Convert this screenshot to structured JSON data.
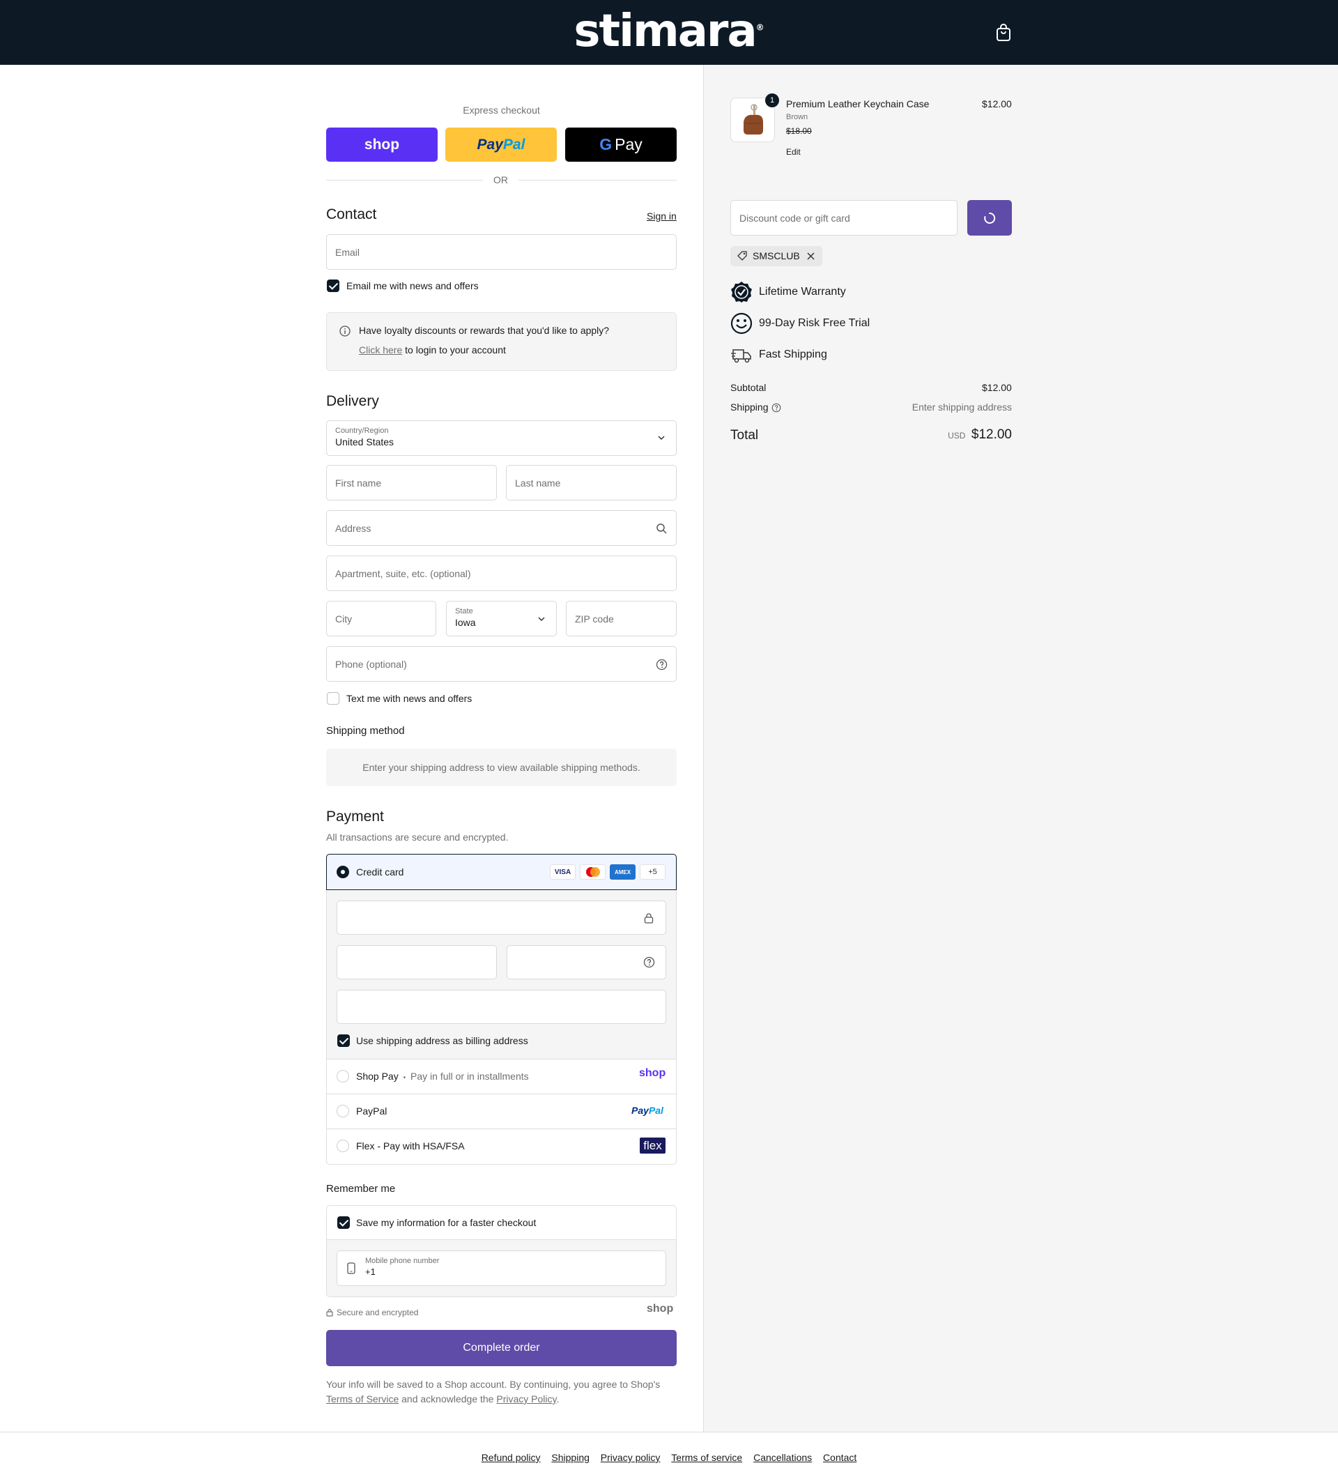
{
  "header": {
    "logo": "stimara",
    "logo_mark": "®"
  },
  "express": {
    "label": "Express checkout",
    "shop_label": "shop",
    "paypal_pay": "Pay",
    "paypal_pal": "Pal",
    "gpay_g": "G",
    "gpay_label": "Pay",
    "or": "OR"
  },
  "contact": {
    "heading": "Contact",
    "sign_in": "Sign in",
    "email_placeholder": "Email",
    "news_label": "Email me with news and offers",
    "loyalty_text": "Have loyalty discounts or rewards that you'd like to apply?",
    "loyalty_link": "Click here",
    "loyalty_suffix": "to login to your account"
  },
  "delivery": {
    "heading": "Delivery",
    "country_label": "Country/Region",
    "country_value": "United States",
    "first_name": "First name",
    "last_name": "Last name",
    "address": "Address",
    "apartment": "Apartment, suite, etc. (optional)",
    "city": "City",
    "state_label": "State",
    "state_value": "Iowa",
    "zip": "ZIP code",
    "phone": "Phone (optional)",
    "text_label": "Text me with news and offers"
  },
  "shipping_method": {
    "heading": "Shipping method",
    "info": "Enter your shipping address to view available shipping methods."
  },
  "payment": {
    "heading": "Payment",
    "subtitle": "All transactions are secure and encrypted.",
    "credit_card": "Credit card",
    "cards": [
      "VISA",
      "AMEX",
      "+5"
    ],
    "billing_label": "Use shipping address as billing address",
    "shop_pay": "Shop Pay",
    "shop_pay_sep": "•",
    "shop_pay_desc": "Pay in full or in installments",
    "shop_logo": "shop",
    "paypal": "PayPal",
    "paypal_pay": "Pay",
    "paypal_pal": "Pal",
    "flex": "Flex - Pay with HSA/FSA",
    "flex_logo": "flex"
  },
  "remember": {
    "heading": "Remember me",
    "save_label": "Save my information for a faster checkout",
    "mobile_label": "Mobile phone number",
    "mobile_value": "+1",
    "secure": "Secure and encrypted",
    "shop_logo": "shop"
  },
  "complete": {
    "button": "Complete order",
    "notice_1": "Your info will be saved to a Shop account. By continuing, you agree to Shop's",
    "tos": "Terms of Service",
    "notice_2": "and acknowledge the",
    "privacy": "Privacy Policy",
    "notice_end": "."
  },
  "summary": {
    "product_name": "Premium Leather Keychain Case",
    "variant": "Brown",
    "old_price": "$18.00",
    "price": "$12.00",
    "qty": "1",
    "edit": "Edit",
    "discount_placeholder": "Discount code or gift card",
    "applied_code": "SMSCLUB",
    "perks": [
      "Lifetime Warranty",
      "99-Day Risk Free Trial",
      "Fast Shipping"
    ],
    "subtotal_label": "Subtotal",
    "subtotal": "$12.00",
    "shipping_label": "Shipping",
    "shipping_value": "Enter shipping address",
    "total_label": "Total",
    "currency": "USD",
    "total": "$12.00"
  },
  "footer": {
    "links": [
      "Refund policy",
      "Shipping",
      "Privacy policy",
      "Terms of service",
      "Cancellations",
      "Contact"
    ]
  },
  "colors": {
    "header_bg": "#0d1a26",
    "accent": "#5f4ba8",
    "shop_purple": "#5a31f4",
    "paypal_yellow": "#ffc439"
  }
}
